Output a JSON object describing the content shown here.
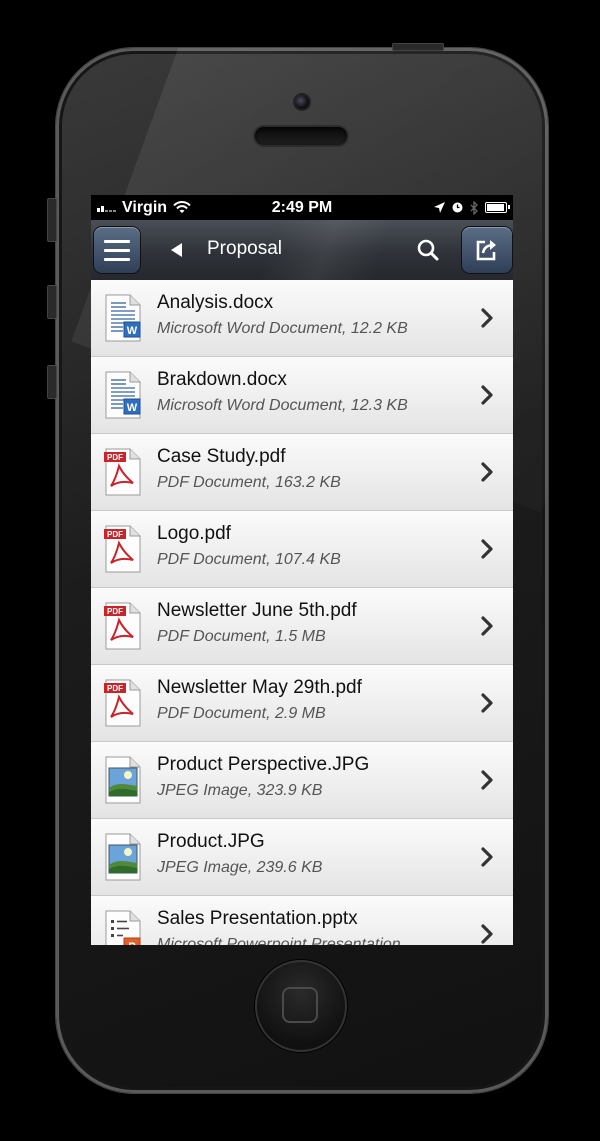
{
  "status_bar": {
    "carrier": "Virgin",
    "time": "2:49 PM"
  },
  "nav": {
    "title": "Proposal",
    "icons": [
      "menu-icon",
      "back-arrow-icon",
      "search-icon",
      "share-icon"
    ]
  },
  "files": [
    {
      "name": "Analysis.docx",
      "desc": "Microsoft Word Document, 12.2 KB",
      "type": "word"
    },
    {
      "name": "Brakdown.docx",
      "desc": "Microsoft Word Document, 12.3 KB",
      "type": "word"
    },
    {
      "name": "Case Study.pdf",
      "desc": "PDF Document, 163.2 KB",
      "type": "pdf"
    },
    {
      "name": "Logo.pdf",
      "desc": "PDF Document, 107.4 KB",
      "type": "pdf"
    },
    {
      "name": "Newsletter June 5th.pdf",
      "desc": "PDF Document, 1.5 MB",
      "type": "pdf"
    },
    {
      "name": "Newsletter May 29th.pdf",
      "desc": "PDF Document, 2.9 MB",
      "type": "pdf"
    },
    {
      "name": "Product Perspective.JPG",
      "desc": "JPEG Image, 323.9 KB",
      "type": "jpg"
    },
    {
      "name": "Product.JPG",
      "desc": "JPEG Image, 239.6 KB",
      "type": "jpg"
    },
    {
      "name": "Sales Presentation.pptx",
      "desc": "Microsoft Powerpoint Presentation",
      "type": "pptx"
    }
  ],
  "colors": {
    "nav_bar": "#2f3339",
    "nav_button": "#3f5068",
    "pdf_red": "#c8252b",
    "word_blue": "#2f6fbf",
    "ppt_orange": "#e0622a"
  }
}
